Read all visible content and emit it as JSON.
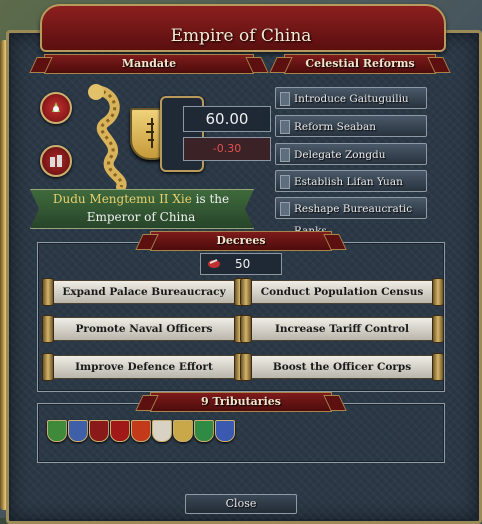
{
  "window": {
    "title": "Empire of China",
    "close_label": "Close"
  },
  "mandate": {
    "header": "Mandate",
    "value": "60.00",
    "change": "-0.30",
    "emperor_name": "Dudu Mengtemu II Xie",
    "emperor_text_1": "is the",
    "emperor_text_2": "Emperor of China"
  },
  "reforms": {
    "header": "Celestial Reforms",
    "items": [
      "Introduce Gaituguiliu",
      "Reform Seaban",
      "Delegate Zongdu",
      "Establish Lifan Yuan",
      "Reshape Bureaucratic Ranks"
    ]
  },
  "decrees": {
    "header": "Decrees",
    "cost": "50",
    "items": [
      "Expand Palace Bureaucracy",
      "Conduct Population Census",
      "Promote Naval Officers",
      "Increase Tariff Control",
      "Improve Defence Effort",
      "Boost the Officer Corps"
    ]
  },
  "tributaries": {
    "header": "9 Tributaries",
    "shields": [
      {
        "color": "#3e8a3a"
      },
      {
        "color": "#3f5fa8"
      },
      {
        "color": "#8a1a1a"
      },
      {
        "color": "#a01818"
      },
      {
        "color": "#c23a1a"
      },
      {
        "color": "#d8d2c4"
      },
      {
        "color": "#c9a84a"
      },
      {
        "color": "#2f8a44"
      },
      {
        "color": "#3b59b0"
      }
    ]
  },
  "colors": {
    "accent_red": "#7e1b1b",
    "gold": "#b89b5a",
    "negative": "#e05050"
  }
}
